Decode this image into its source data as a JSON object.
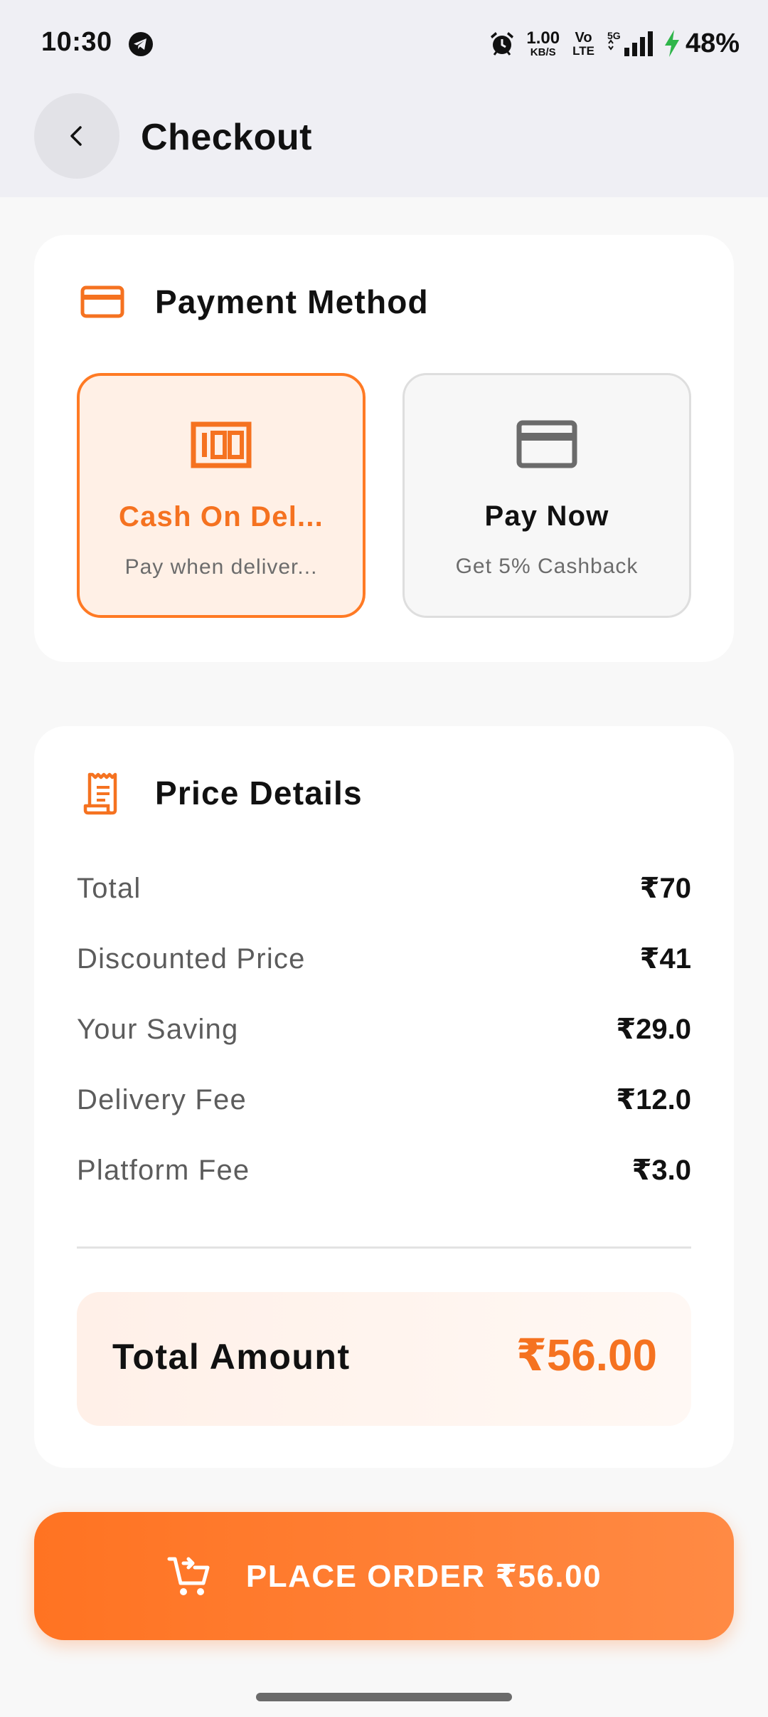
{
  "status_bar": {
    "time": "10:30",
    "net_speed_value": "1.00",
    "net_speed_unit": "KB/S",
    "volte_top": "Vo",
    "volte_bottom": "LTE",
    "network": "5G",
    "battery": "48%",
    "icons": [
      "telegram-icon",
      "alarm-icon",
      "signal-icon",
      "charging-bolt-icon"
    ]
  },
  "header": {
    "title": "Checkout",
    "back_icon": "chevron-left-icon"
  },
  "payment_method": {
    "heading": "Payment Method",
    "heading_icon": "credit-card-icon",
    "options": [
      {
        "title": "Cash On Del...",
        "subtitle": "Pay when deliver...",
        "icon": "cash-note-icon",
        "selected": true
      },
      {
        "title": "Pay Now",
        "subtitle": "Get 5% Cashback",
        "icon": "credit-card-icon",
        "selected": false
      }
    ]
  },
  "price_details": {
    "heading": "Price Details",
    "heading_icon": "receipt-icon",
    "rows": [
      {
        "label": "Total",
        "value": "₹70"
      },
      {
        "label": "Discounted Price",
        "value": "₹41"
      },
      {
        "label": "Your Saving",
        "value": "₹29.0"
      },
      {
        "label": "Delivery Fee",
        "value": "₹12.0"
      },
      {
        "label": "Platform Fee",
        "value": "₹3.0"
      }
    ],
    "total_label": "Total Amount",
    "total_value": "₹56.00"
  },
  "place_order": {
    "label": "PLACE ORDER ₹56.00",
    "icon": "add-to-cart-icon"
  },
  "colors": {
    "accent": "#ff7322",
    "accent_text": "#f57220",
    "selected_bg": "#fff0e6",
    "header_bg": "#efeff4"
  }
}
